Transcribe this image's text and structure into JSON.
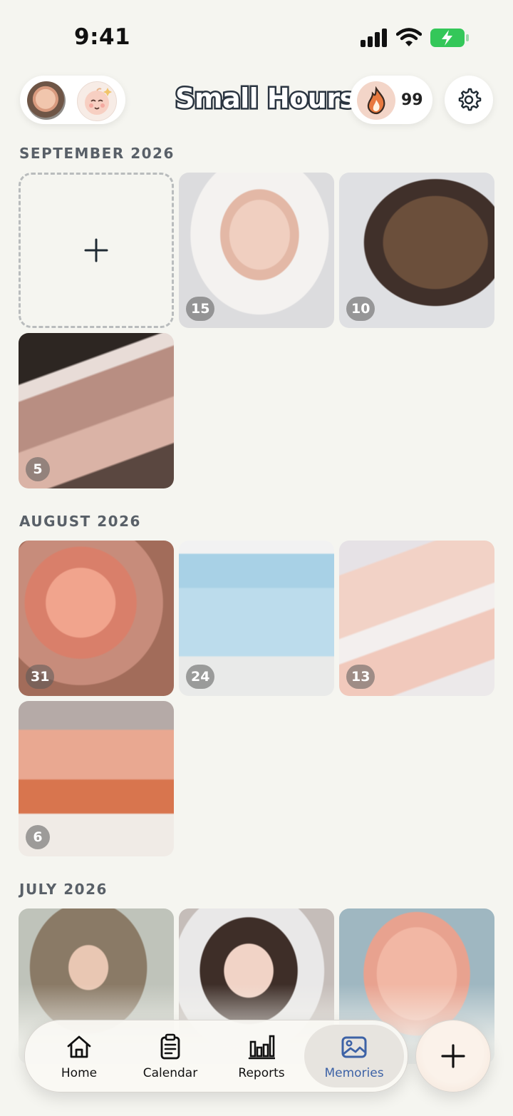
{
  "status_bar": {
    "time": "9:41"
  },
  "header": {
    "title": "Small Hours",
    "streak_count": "99"
  },
  "sections": [
    {
      "title": "SEPTEMBER 2026",
      "photos": [
        {
          "day": "15"
        },
        {
          "day": "10"
        },
        {
          "day": "5"
        }
      ]
    },
    {
      "title": "AUGUST 2026",
      "photos": [
        {
          "day": "31"
        },
        {
          "day": "24"
        },
        {
          "day": "13"
        },
        {
          "day": "6"
        }
      ]
    },
    {
      "title": "JULY 2026",
      "photos": []
    }
  ],
  "tabbar": {
    "tabs": [
      {
        "label": "Home",
        "icon": "home-icon"
      },
      {
        "label": "Calendar",
        "icon": "calendar-icon"
      },
      {
        "label": "Reports",
        "icon": "bar-chart-icon"
      },
      {
        "label": "Memories",
        "icon": "photo-icon",
        "active": true
      }
    ]
  },
  "colors": {
    "accent": "#3d62a6",
    "background": "#f5f5f0",
    "battery": "#34c759"
  }
}
